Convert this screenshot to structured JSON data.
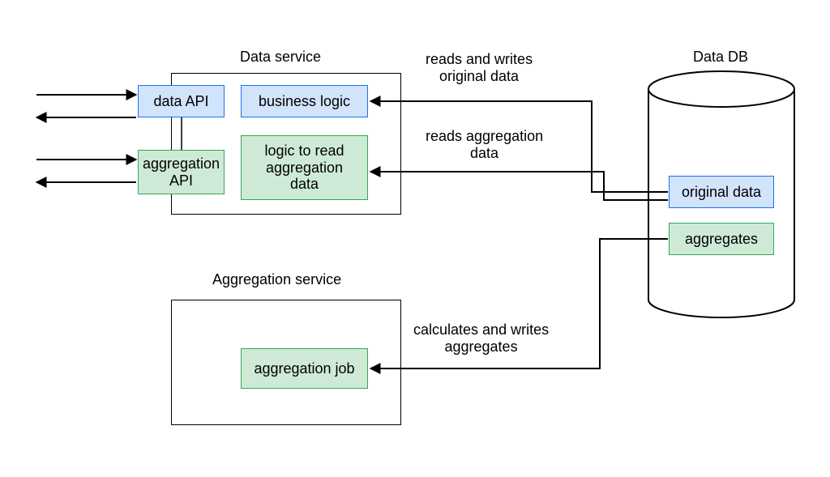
{
  "titles": {
    "data_service": "Data service",
    "aggregation_service": "Aggregation service",
    "data_db": "Data DB"
  },
  "chips": {
    "data_api": "data API",
    "business_logic": "business logic",
    "aggregation_api": "aggregation\nAPI",
    "logic_read_agg": "logic to read\naggregation\ndata",
    "aggregation_job": "aggregation job",
    "original_data": "original data",
    "aggregates": "aggregates"
  },
  "edges": {
    "rw_original": "reads and writes\noriginal data",
    "reads_agg": "reads aggregation\ndata",
    "calc_writes": "calculates and writes\naggregates"
  }
}
